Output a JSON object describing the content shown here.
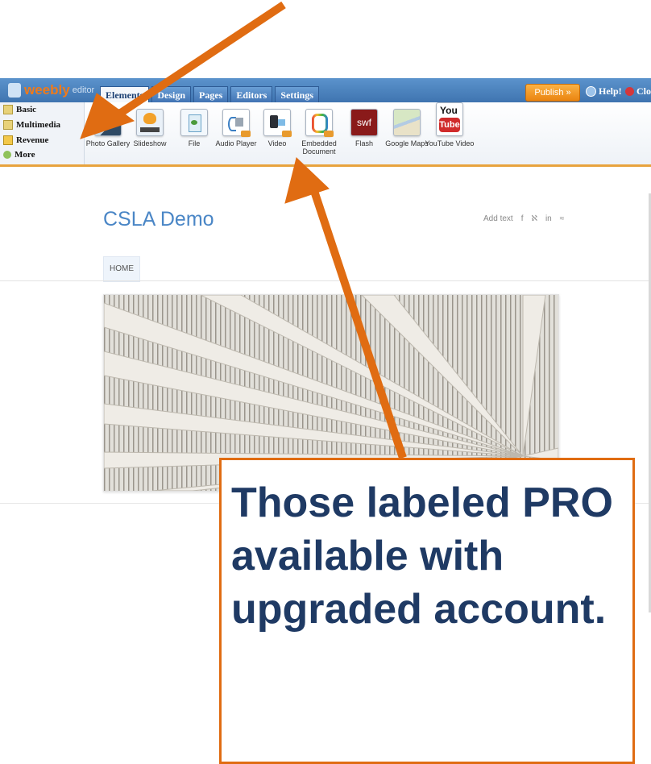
{
  "editor": {
    "logo_brand": "weebly",
    "logo_suffix": "editor",
    "tabs": [
      "Elements",
      "Design",
      "Pages",
      "Editors",
      "Settings"
    ],
    "publish_label": "Publish »",
    "help_label": "Help!",
    "close_label": "Close"
  },
  "sidebar": {
    "items": [
      {
        "label": "Basic"
      },
      {
        "label": "Multimedia"
      },
      {
        "label": "Revenue"
      },
      {
        "label": "More"
      }
    ]
  },
  "elements": [
    {
      "label": "Photo Gallery",
      "icon": "photo-gallery-icon",
      "pro": false
    },
    {
      "label": "Slideshow",
      "icon": "slideshow-icon",
      "pro": false
    },
    {
      "label": "File",
      "icon": "file-icon",
      "pro": false
    },
    {
      "label": "Audio Player",
      "icon": "audio-player-icon",
      "pro": true
    },
    {
      "label": "Video",
      "icon": "video-icon",
      "pro": true
    },
    {
      "label": "Embedded Document",
      "icon": "embedded-document-icon",
      "pro": true
    },
    {
      "label": "Flash",
      "icon": "flash-icon",
      "pro": false,
      "icon_text": "swf"
    },
    {
      "label": "Google Maps",
      "icon": "google-maps-icon",
      "pro": false
    },
    {
      "label": "YouTube Video",
      "icon": "youtube-icon",
      "pro": false,
      "icon_text_1": "You",
      "icon_text_2": "Tube"
    }
  ],
  "site": {
    "title": "CSLA Demo",
    "add_text": "Add text",
    "social": [
      "f",
      "ℵ",
      "in",
      "≈"
    ],
    "nav_home": "HOME"
  },
  "callout": {
    "text": "Those labeled PRO available with upgraded account."
  },
  "colors": {
    "arrow": "#e06c12",
    "callout_text": "#1f3a64",
    "title_blue": "#4a86c6",
    "publish_orange": "#ea8410"
  }
}
